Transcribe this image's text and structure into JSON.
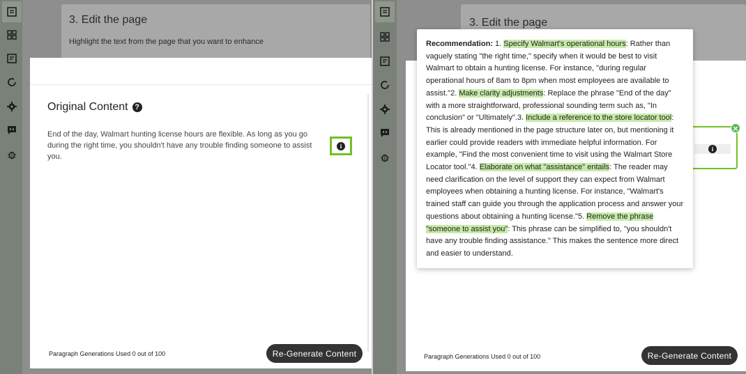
{
  "page": {
    "step_title": "3. Edit the page",
    "step_subtitle": "Highlight the text from the page that you want to enhance"
  },
  "left_modal": {
    "original_title": "Original Content",
    "original_text": "End of the day, Walmart hunting license hours are flexible. As long as you go during the right time, you shouldn't have any trouble finding someone to assist you.",
    "footer": "Paragraph Generations Used 0 out of 100",
    "regen_label": "Re-Generate Content"
  },
  "right_modal": {
    "footer": "Paragraph Generations Used 0 out of 100",
    "regen_label": "Re-Generate Content"
  },
  "recommendation": {
    "label": "Recommendation:",
    "segments": [
      {
        "text": " 1. ",
        "hl": false
      },
      {
        "text": "Specify Walmart's operational hours",
        "hl": true
      },
      {
        "text": ": Rather than vaguely stating \"the right time,\" specify when it would be best to visit Walmart to obtain a hunting license. For instance, \"during regular operational hours of 8am to 8pm when most employees are available to assist.\"2. ",
        "hl": false
      },
      {
        "text": "Make clarity adjustments",
        "hl": true
      },
      {
        "text": ": Replace the phrase \"End of the day\" with a more straightforward, professional sounding term such as, \"In conclusion\" or \"Ultimately\".3. ",
        "hl": false
      },
      {
        "text": "Include a reference to the store locator tool",
        "hl": true
      },
      {
        "text": ": This is already mentioned in the page structure later on, but mentioning it earlier could provide readers with immediate helpful information. For example, \"Find the most convenient time to visit using the Walmart Store Locator tool.\"4. ",
        "hl": false
      },
      {
        "text": "Elaborate on what \"assistance\" entails",
        "hl": true
      },
      {
        "text": ": The reader may need clarification on the level of support they can expect from Walmart employees when obtaining a hunting license. For instance, \"Walmart's trained staff can guide you through the application process and answer your questions about obtaining a hunting license.\"5. ",
        "hl": false
      },
      {
        "text": "Remove the phrase \"someone to assist you\"",
        "hl": true
      },
      {
        "text": ": This phrase can be simplified to, \"you shouldn't have any trouble finding assistance.\" This makes the sentence more direct and easier to understand.",
        "hl": false
      }
    ]
  },
  "sidebar_icons": [
    "notes-icon",
    "dashboard-icon",
    "notes-icon",
    "refresh-icon",
    "gear-icon",
    "quote-icon",
    "bug-icon"
  ],
  "colors": {
    "highlight": "#c7eaa9",
    "accent_green": "#72c025",
    "button_dark": "#333333",
    "sidebar": "#7a8178"
  }
}
